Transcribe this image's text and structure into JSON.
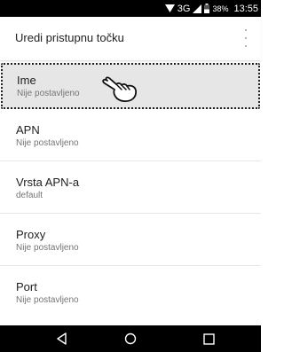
{
  "status": {
    "network": "3G",
    "battery_pct": "38%",
    "time": "13:55"
  },
  "appbar": {
    "title": "Uredi pristupnu točku"
  },
  "prefs": [
    {
      "title": "Ime",
      "summary": "Nije postavljeno"
    },
    {
      "title": "APN",
      "summary": "Nije postavljeno"
    },
    {
      "title": "Vrsta APN-a",
      "summary": "default"
    },
    {
      "title": "Proxy",
      "summary": "Nije postavljeno"
    },
    {
      "title": "Port",
      "summary": "Nije postavljeno"
    }
  ],
  "icons": [
    "wifi-icon",
    "signal-icon",
    "battery-icon",
    "more-options-icon",
    "pointer-hand-icon",
    "back-icon",
    "home-icon",
    "recents-icon"
  ]
}
